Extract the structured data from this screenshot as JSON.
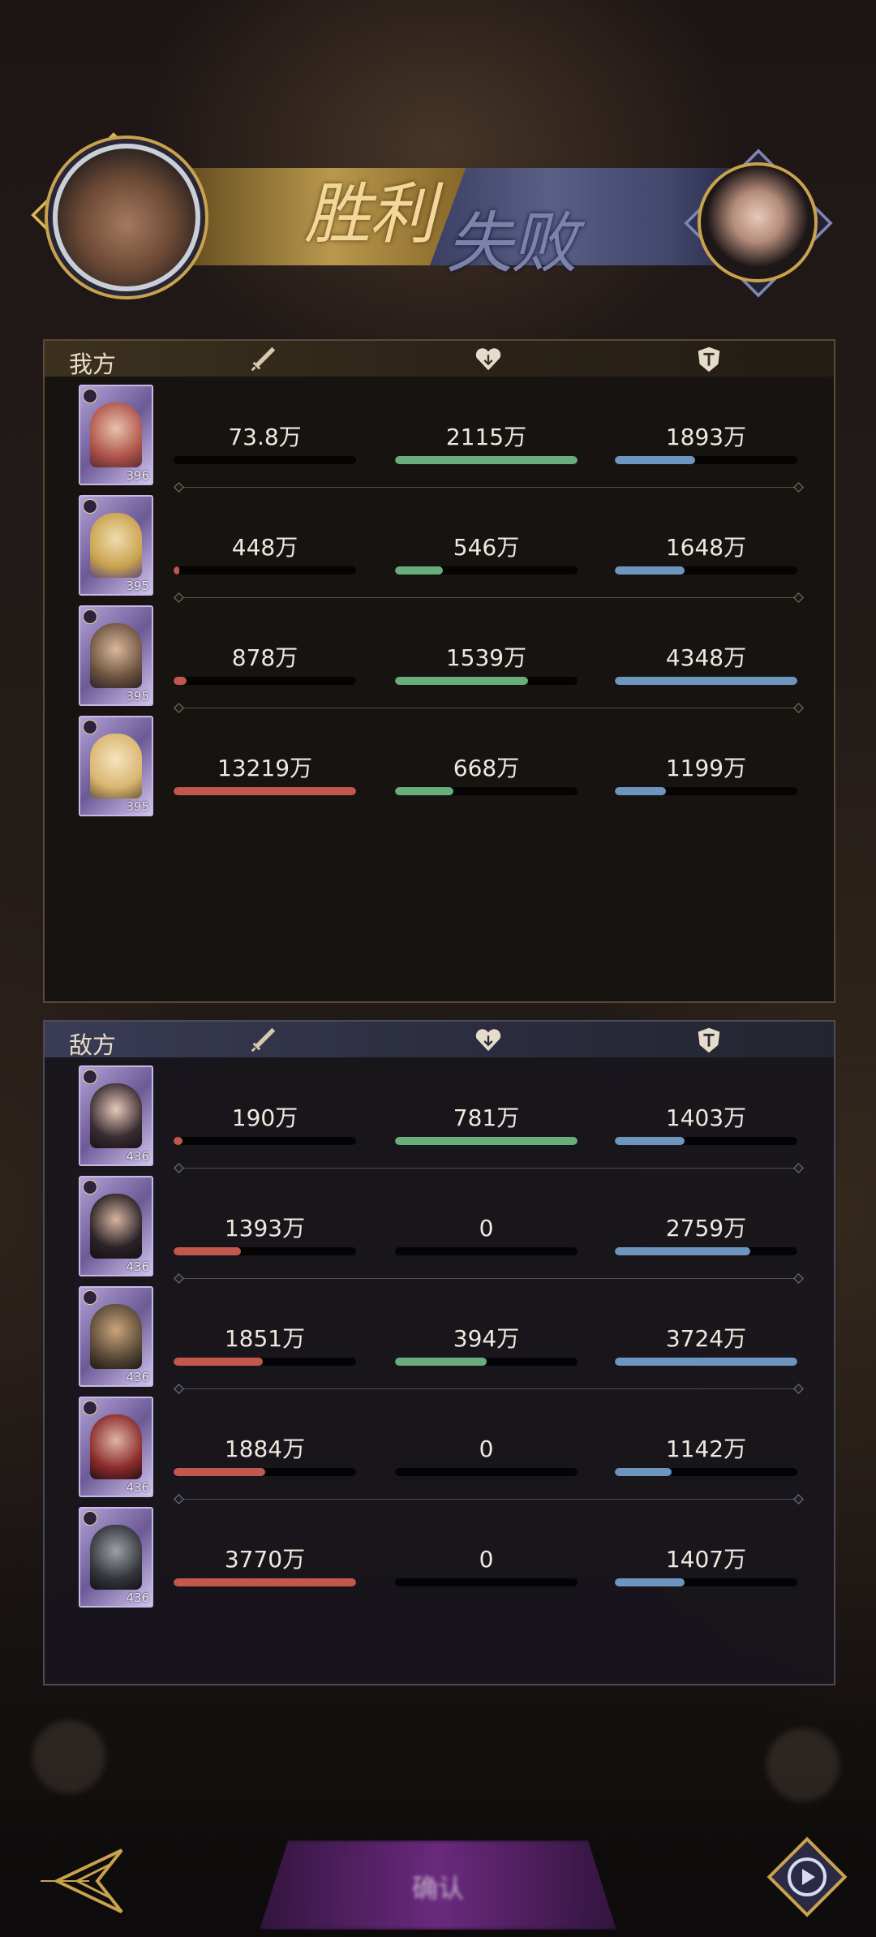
{
  "header": {
    "victory_text": "胜利",
    "defeat_text": "失败"
  },
  "ours": {
    "label": "我方",
    "icons": [
      "sword-icon",
      "heart-icon",
      "shield-icon"
    ],
    "rows": [
      {
        "level": "396",
        "damage": "73.8万",
        "heal": "2115万",
        "tank": "1893万",
        "damage_fill": 0.0,
        "heal_fill": 1.0,
        "tank_fill": 0.44
      },
      {
        "level": "395",
        "damage": "448万",
        "heal": "546万",
        "tank": "1648万",
        "damage_fill": 0.03,
        "heal_fill": 0.26,
        "tank_fill": 0.38
      },
      {
        "level": "395",
        "damage": "878万",
        "heal": "1539万",
        "tank": "4348万",
        "damage_fill": 0.07,
        "heal_fill": 0.73,
        "tank_fill": 1.0
      },
      {
        "level": "395",
        "damage": "13219万",
        "heal": "668万",
        "tank": "1199万",
        "damage_fill": 1.0,
        "heal_fill": 0.32,
        "tank_fill": 0.28
      }
    ]
  },
  "enemy": {
    "label": "敌方",
    "icons": [
      "sword-icon",
      "heart-icon",
      "shield-icon"
    ],
    "rows": [
      {
        "level": "436",
        "damage": "190万",
        "heal": "781万",
        "tank": "1403万",
        "damage_fill": 0.05,
        "heal_fill": 1.0,
        "tank_fill": 0.38
      },
      {
        "level": "436",
        "damage": "1393万",
        "heal": "0",
        "tank": "2759万",
        "damage_fill": 0.37,
        "heal_fill": 0.0,
        "tank_fill": 0.74
      },
      {
        "level": "436",
        "damage": "1851万",
        "heal": "394万",
        "tank": "3724万",
        "damage_fill": 0.49,
        "heal_fill": 0.5,
        "tank_fill": 1.0
      },
      {
        "level": "436",
        "damage": "1884万",
        "heal": "0",
        "tank": "1142万",
        "damage_fill": 0.5,
        "heal_fill": 0.0,
        "tank_fill": 0.31
      },
      {
        "level": "436",
        "damage": "3770万",
        "heal": "0",
        "tank": "1407万",
        "damage_fill": 1.0,
        "heal_fill": 0.0,
        "tank_fill": 0.38
      }
    ]
  },
  "footer": {
    "main_button_label": "确认",
    "back_icon": "back-arrow-icon",
    "replay_icon": "replay-icon"
  },
  "colors": {
    "damage": "#c2574e",
    "heal": "#69ad7c",
    "tank": "#6e95bd",
    "gold": "#c9a24d"
  }
}
